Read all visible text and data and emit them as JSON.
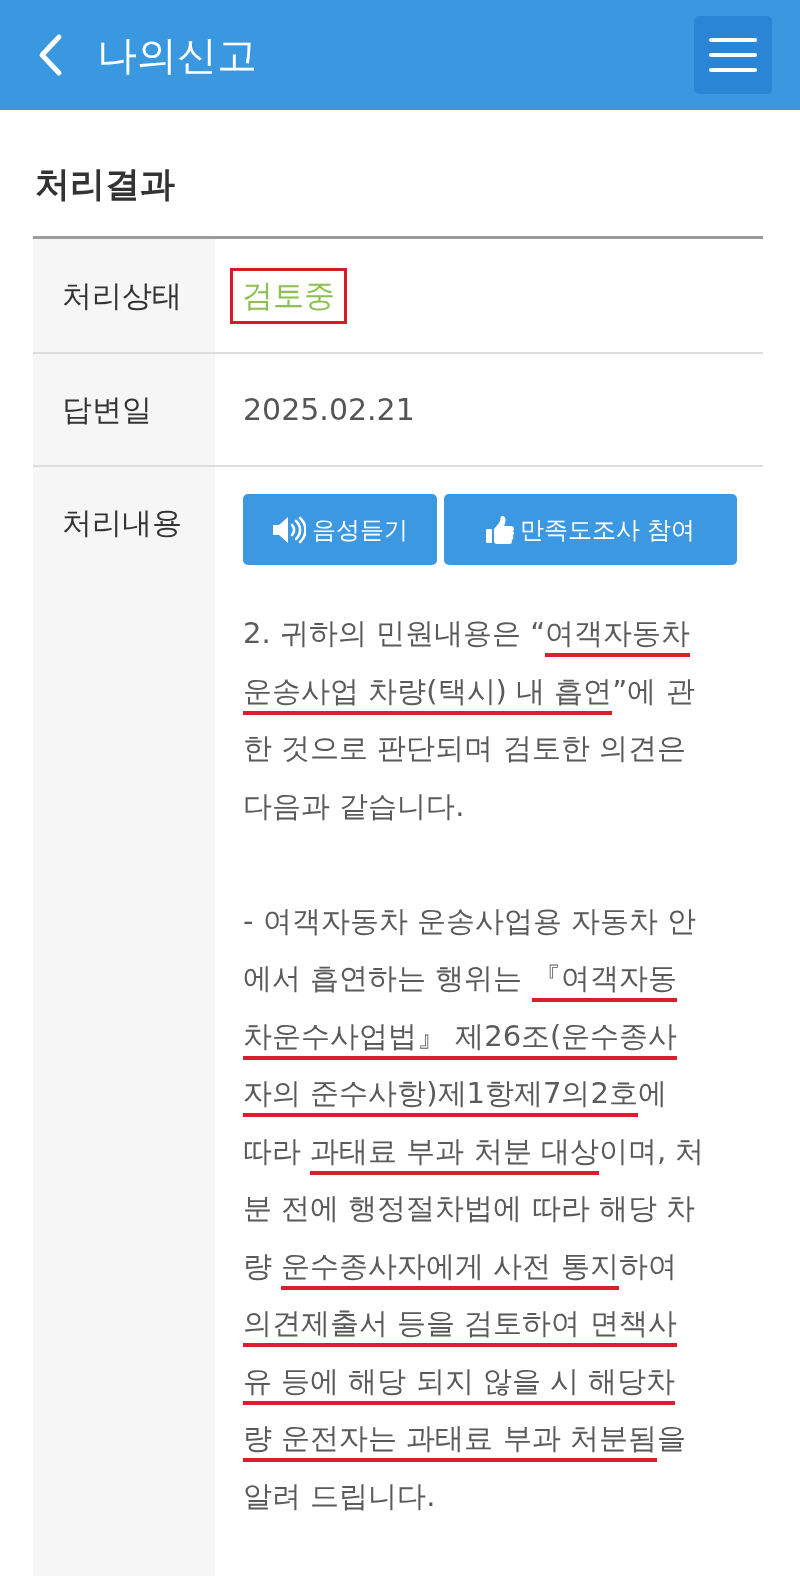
{
  "header": {
    "title": "나의신고"
  },
  "section": {
    "title": "처리결과"
  },
  "rows": [
    {
      "kind": "status",
      "label": "처리상태",
      "value": "검토중",
      "marked": true
    },
    {
      "kind": "date",
      "label": "답변일",
      "value": "2025.02.21"
    },
    {
      "kind": "content",
      "label": "처리내용",
      "buttons": [
        {
          "kind": "audio",
          "label": "음성듣기"
        },
        {
          "kind": "survey",
          "label": "만족도조사 참여"
        }
      ],
      "paragraphs": [
        {
          "lines": [
            [
              {
                "text": "2. 귀하의 민원내용은 “",
                "underlined": false
              },
              {
                "text": "여객자동차",
                "underlined": true
              }
            ],
            [
              {
                "text": "운송사업 차량(택시) 내 흡연",
                "underlined": true
              },
              {
                "text": "”에 관",
                "underlined": false
              }
            ],
            [
              {
                "text": "한 것으로 판단되며 검토한 의견은",
                "underlined": false
              }
            ],
            [
              {
                "text": "다음과 같습니다.",
                "underlined": false
              }
            ]
          ]
        },
        {
          "lines": [
            [
              {
                "text": "- 여객자동차 운송사업용 자동차 안",
                "underlined": false
              }
            ],
            [
              {
                "text": "에서 흡연하는 행위는 ",
                "underlined": false
              },
              {
                "text": "『여객자동",
                "underlined": true
              }
            ],
            [
              {
                "text": "차운수사업법』 제26조(운수종사",
                "underlined": true
              }
            ],
            [
              {
                "text": "자의 준수사항)제1항제7의2호",
                "underlined": true
              },
              {
                "text": "에",
                "underlined": false
              }
            ],
            [
              {
                "text": "따라 ",
                "underlined": false
              },
              {
                "text": "과태료 부과 처분 대상",
                "underlined": true
              },
              {
                "text": "이며, 처",
                "underlined": false
              }
            ],
            [
              {
                "text": "분 전에 행정절차법에 따라 해당 차",
                "underlined": false
              }
            ],
            [
              {
                "text": "량 ",
                "underlined": false
              },
              {
                "text": "운수종사자에게 사전 통지",
                "underlined": true
              },
              {
                "text": "하여",
                "underlined": false
              }
            ],
            [
              {
                "text": "의견제출서 등을 검토하여 면책사",
                "underlined": true
              }
            ],
            [
              {
                "text": "유 등에 해당 되지 않을 시 해당차",
                "underlined": true
              }
            ],
            [
              {
                "text": "량 운전자는 과태료 부과 처분됨",
                "underlined": true
              },
              {
                "text": "을",
                "underlined": false
              }
            ],
            [
              {
                "text": "알려 드립니다.",
                "underlined": false
              }
            ]
          ]
        }
      ]
    }
  ]
}
